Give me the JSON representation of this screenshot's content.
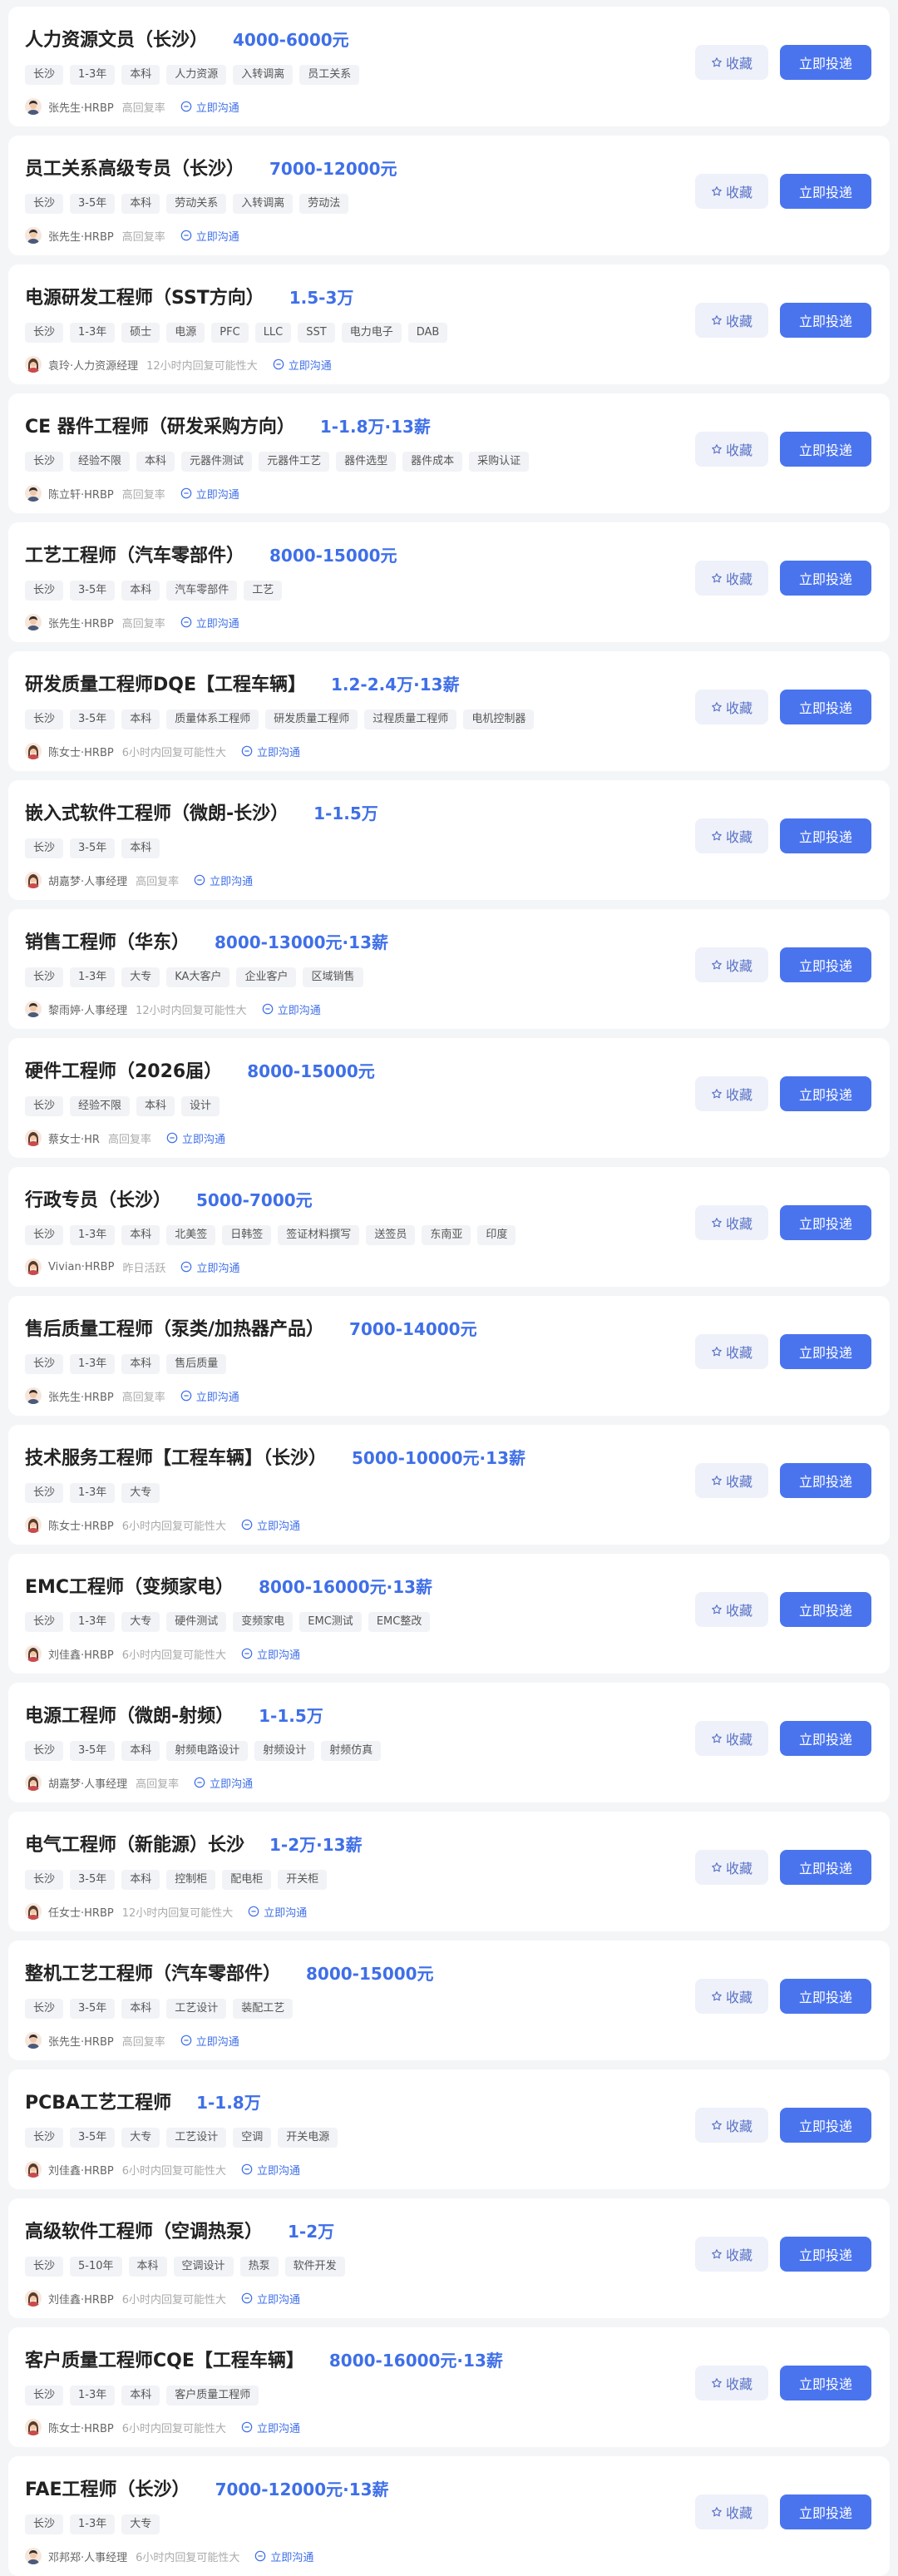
{
  "ui": {
    "favorite_label": "收藏",
    "apply_label": "立即投递",
    "chat_label": "立即沟通"
  },
  "jobs": [
    {
      "title": "人力资源文员（长沙）",
      "salary": "4000-6000元",
      "tags": [
        "长沙",
        "1-3年",
        "本科",
        "人力资源",
        "入转调离",
        "员工关系"
      ],
      "recruiter": "张先生·HRBP",
      "status": "高回复率",
      "avatar": "male"
    },
    {
      "title": "员工关系高级专员（长沙）",
      "salary": "7000-12000元",
      "tags": [
        "长沙",
        "3-5年",
        "本科",
        "劳动关系",
        "入转调离",
        "劳动法"
      ],
      "recruiter": "张先生·HRBP",
      "status": "高回复率",
      "avatar": "male"
    },
    {
      "title": "电源研发工程师（SST方向）",
      "salary": "1.5-3万",
      "tags": [
        "长沙",
        "1-3年",
        "硕士",
        "电源",
        "PFC",
        "LLC",
        "SST",
        "电力电子",
        "DAB"
      ],
      "recruiter": "袁玲·人力资源经理",
      "status": "12小时内回复可能性大",
      "avatar": "female"
    },
    {
      "title": "CE 器件工程师（研发采购方向）",
      "salary": "1-1.8万·13薪",
      "tags": [
        "长沙",
        "经验不限",
        "本科",
        "元器件测试",
        "元器件工艺",
        "器件选型",
        "器件成本",
        "采购认证"
      ],
      "recruiter": "陈立轩·HRBP",
      "status": "高回复率",
      "avatar": "male"
    },
    {
      "title": "工艺工程师（汽车零部件）",
      "salary": "8000-15000元",
      "tags": [
        "长沙",
        "3-5年",
        "本科",
        "汽车零部件",
        "工艺"
      ],
      "recruiter": "张先生·HRBP",
      "status": "高回复率",
      "avatar": "male"
    },
    {
      "title": "研发质量工程师DQE【工程车辆】",
      "salary": "1.2-2.4万·13薪",
      "tags": [
        "长沙",
        "3-5年",
        "本科",
        "质量体系工程师",
        "研发质量工程师",
        "过程质量工程师",
        "电机控制器"
      ],
      "recruiter": "陈女士·HRBP",
      "status": "6小时内回复可能性大",
      "avatar": "female"
    },
    {
      "title": "嵌入式软件工程师（微朗-长沙）",
      "salary": "1-1.5万",
      "tags": [
        "长沙",
        "3-5年",
        "本科"
      ],
      "recruiter": "胡嘉梦·人事经理",
      "status": "高回复率",
      "avatar": "female"
    },
    {
      "title": "销售工程师（华东）",
      "salary": "8000-13000元·13薪",
      "tags": [
        "长沙",
        "1-3年",
        "大专",
        "KA大客户",
        "企业客户",
        "区域销售"
      ],
      "recruiter": "黎雨婷·人事经理",
      "status": "12小时内回复可能性大",
      "avatar": "male"
    },
    {
      "title": "硬件工程师（2026届）",
      "salary": "8000-15000元",
      "tags": [
        "长沙",
        "经验不限",
        "本科",
        "设计"
      ],
      "recruiter": "蔡女士·HR",
      "status": "高回复率",
      "avatar": "female"
    },
    {
      "title": "行政专员（长沙）",
      "salary": "5000-7000元",
      "tags": [
        "长沙",
        "1-3年",
        "本科",
        "北美签",
        "日韩签",
        "签证材料撰写",
        "送签员",
        "东南亚",
        "印度"
      ],
      "recruiter": "Vivian·HRBP",
      "status": "昨日活跃",
      "avatar": "female"
    },
    {
      "title": "售后质量工程师（泵类/加热器产品）",
      "salary": "7000-14000元",
      "tags": [
        "长沙",
        "1-3年",
        "本科",
        "售后质量"
      ],
      "recruiter": "张先生·HRBP",
      "status": "高回复率",
      "avatar": "male"
    },
    {
      "title": "技术服务工程师【工程车辆】（长沙）",
      "salary": "5000-10000元·13薪",
      "tags": [
        "长沙",
        "1-3年",
        "大专"
      ],
      "recruiter": "陈女士·HRBP",
      "status": "6小时内回复可能性大",
      "avatar": "female"
    },
    {
      "title": "EMC工程师（变频家电）",
      "salary": "8000-16000元·13薪",
      "tags": [
        "长沙",
        "1-3年",
        "大专",
        "硬件测试",
        "变频家电",
        "EMC测试",
        "EMC整改"
      ],
      "recruiter": "刘佳鑫·HRBP",
      "status": "6小时内回复可能性大",
      "avatar": "female"
    },
    {
      "title": "电源工程师（微朗-射频）",
      "salary": "1-1.5万",
      "tags": [
        "长沙",
        "3-5年",
        "本科",
        "射频电路设计",
        "射频设计",
        "射频仿真"
      ],
      "recruiter": "胡嘉梦·人事经理",
      "status": "高回复率",
      "avatar": "female"
    },
    {
      "title": "电气工程师（新能源）长沙",
      "salary": "1-2万·13薪",
      "tags": [
        "长沙",
        "3-5年",
        "本科",
        "控制柜",
        "配电柜",
        "开关柜"
      ],
      "recruiter": "任女士·HRBP",
      "status": "12小时内回复可能性大",
      "avatar": "female"
    },
    {
      "title": "整机工艺工程师（汽车零部件）",
      "salary": "8000-15000元",
      "tags": [
        "长沙",
        "3-5年",
        "本科",
        "工艺设计",
        "装配工艺"
      ],
      "recruiter": "张先生·HRBP",
      "status": "高回复率",
      "avatar": "male"
    },
    {
      "title": "PCBA工艺工程师",
      "salary": "1-1.8万",
      "tags": [
        "长沙",
        "3-5年",
        "大专",
        "工艺设计",
        "空调",
        "开关电源"
      ],
      "recruiter": "刘佳鑫·HRBP",
      "status": "6小时内回复可能性大",
      "avatar": "female"
    },
    {
      "title": "高级软件工程师（空调热泵）",
      "salary": "1-2万",
      "tags": [
        "长沙",
        "5-10年",
        "本科",
        "空调设计",
        "热泵",
        "软件开发"
      ],
      "recruiter": "刘佳鑫·HRBP",
      "status": "6小时内回复可能性大",
      "avatar": "female"
    },
    {
      "title": "客户质量工程师CQE【工程车辆】",
      "salary": "8000-16000元·13薪",
      "tags": [
        "长沙",
        "1-3年",
        "本科",
        "客户质量工程师"
      ],
      "recruiter": "陈女士·HRBP",
      "status": "6小时内回复可能性大",
      "avatar": "female"
    },
    {
      "title": "FAE工程师（长沙）",
      "salary": "7000-12000元·13薪",
      "tags": [
        "长沙",
        "1-3年",
        "大专"
      ],
      "recruiter": "邓邦郑·人事经理",
      "status": "6小时内回复可能性大",
      "avatar": "male"
    }
  ]
}
